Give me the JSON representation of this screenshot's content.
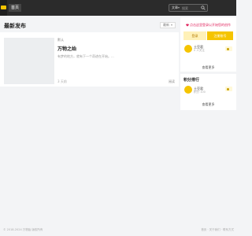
{
  "nav": {
    "home_label": "首页"
  },
  "search": {
    "scope": "文章",
    "placeholder": "搜索"
  },
  "main": {
    "title": "最新发布",
    "sort_label": "最新"
  },
  "feed": {
    "items": [
      {
        "category": "默认",
        "title": "万物之始",
        "excerpt": "有梦的地方，就有下一个奇迹在开始。...",
        "time": "3 天前",
        "action": "阅读"
      }
    ]
  },
  "sidebar": {
    "promo": {
      "text": "点击这里登录以开始您的创作",
      "login_label": "登录",
      "register_label": "注册账号"
    },
    "user": {
      "name": "土豆君",
      "sub": "0 人关注",
      "more_label": "查看更多"
    },
    "rank": {
      "title": "积分排行",
      "user_name": "土豆君",
      "user_sub": "积分 100",
      "more_label": "查看更多"
    }
  },
  "footer": {
    "copyright": "© 2018-2024 万物始 版权所有",
    "right_text": "首页 · 关于我们 · 联系方式"
  },
  "colors": {
    "accent": "#f5c400",
    "topbar": "#2b2b2b",
    "promo_text": "#e0245e"
  }
}
